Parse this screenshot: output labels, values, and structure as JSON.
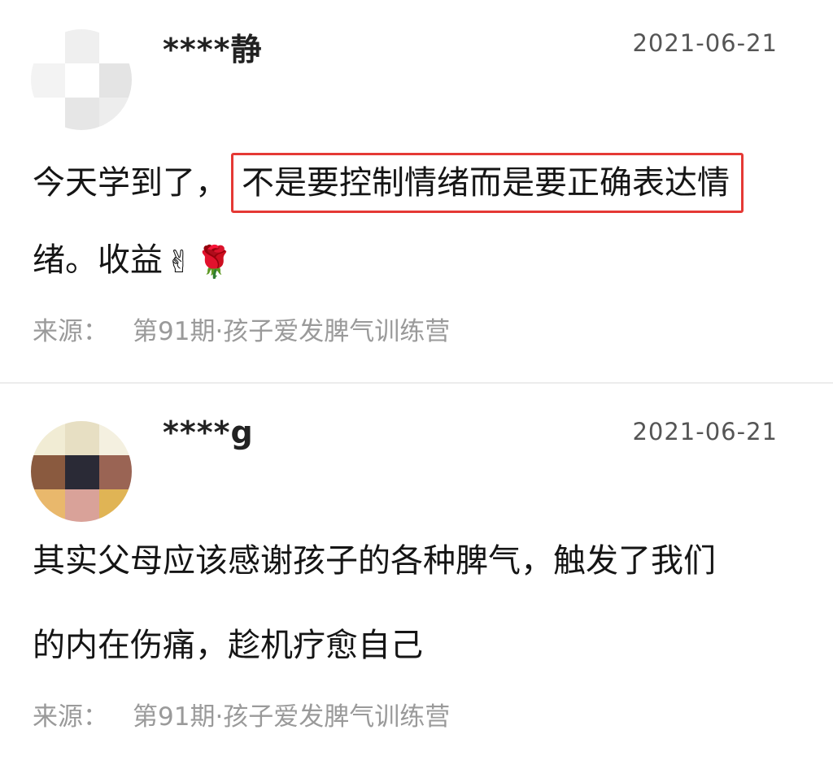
{
  "comments": [
    {
      "username": "****静",
      "date": "2021-06-21",
      "text_before": "今天学到了，",
      "highlight": "不是要控制情绪而是要正确表达情",
      "line2": "绪。收益",
      "emojis": [
        "✌",
        "🌹"
      ],
      "source_label": "来源：",
      "source_value": "第91期·孩子爱发脾气训练营",
      "avatar_colors": [
        "#ffffff",
        "#efefef",
        "#ffffff",
        "#f3f3f3",
        "#ffffff",
        "#e4e4e4",
        "#ffffff",
        "#e6e6e6",
        "#ededed"
      ]
    },
    {
      "username": "****g",
      "date": "2021-06-21",
      "line1": "其实父母应该感谢孩子的各种脾气，触发了我们",
      "line2": "的内在伤痛，趁机疗愈自己",
      "source_label": "来源：",
      "source_value": "第91期·孩子爱发脾气训练营",
      "avatar_colors": [
        "#f1ecd4",
        "#e7dfc3",
        "#f4f0e0",
        "#8a5a3f",
        "#2a2a36",
        "#9a6454",
        "#e9b86c",
        "#d9a299",
        "#e0b455"
      ]
    }
  ]
}
